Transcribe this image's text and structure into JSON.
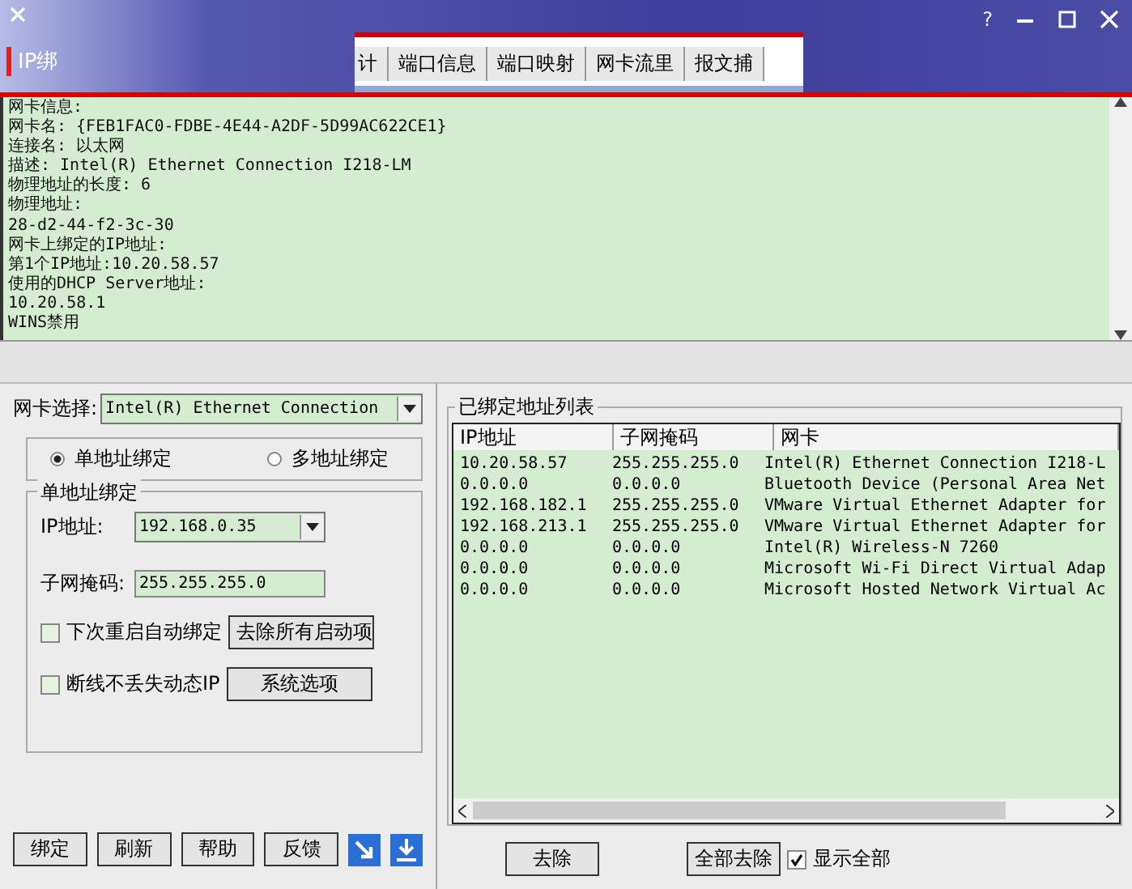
{
  "title_bar": {
    "app_tab": "IP绑",
    "tabs": [
      {
        "label": "计",
        "selected": false
      },
      {
        "label": "端口信息",
        "selected": false
      },
      {
        "label": "端口映射",
        "selected": false
      },
      {
        "label": "网卡流里",
        "selected": false
      },
      {
        "label": "报文捕",
        "selected": false
      }
    ],
    "help": "?"
  },
  "info": {
    "lines": [
      "网卡信息:",
      "网卡名: {FEB1FAC0-FDBE-4E44-A2DF-5D99AC622CE1}",
      "连接名: 以太网",
      "描述: Intel(R) Ethernet Connection I218-LM",
      "物理地址的长度: 6",
      "物理地址:",
      "28-d2-44-f2-3c-30",
      "网卡上绑定的IP地址:",
      "第1个IP地址:10.20.58.57",
      "使用的DHCP Server地址:",
      "10.20.58.1",
      "WINS禁用"
    ]
  },
  "left_panel": {
    "adapter_label": "网卡选择:",
    "adapter_value": "Intel(R) Ethernet Connection",
    "modes": [
      {
        "label": "单地址绑定",
        "selected": true
      },
      {
        "label": "多地址绑定",
        "selected": false
      }
    ],
    "group_title": "单地址绑定",
    "ip_label": "IP地址:",
    "ip_value": "192.168.0.35",
    "mask_label": "子网掩码:",
    "mask_value": "255.255.255.0",
    "options": [
      {
        "label": "下次重启自动绑定",
        "checked": false,
        "button": "去除所有启动项"
      },
      {
        "label": "断线不丢失动态IP",
        "checked": false,
        "button": "系统选项"
      }
    ],
    "buttons": [
      "绑定",
      "刷新",
      "帮助",
      "反馈"
    ]
  },
  "right_panel": {
    "group_title": "已绑定地址列表",
    "columns": [
      "IP地址",
      "子网掩码",
      "网卡"
    ],
    "rows": [
      [
        "10.20.58.57",
        "255.255.255.0",
        "Intel(R) Ethernet Connection I218-L"
      ],
      [
        "0.0.0.0",
        "0.0.0.0",
        "Bluetooth Device (Personal Area Net"
      ],
      [
        "192.168.182.1",
        "255.255.255.0",
        "VMware Virtual Ethernet Adapter for"
      ],
      [
        "192.168.213.1",
        "255.255.255.0",
        "VMware Virtual Ethernet Adapter for"
      ],
      [
        "0.0.0.0",
        "0.0.0.0",
        "Intel(R) Wireless-N 7260"
      ],
      [
        "0.0.0.0",
        "0.0.0.0",
        "Microsoft Wi-Fi Direct Virtual Adap"
      ],
      [
        "0.0.0.0",
        "0.0.0.0",
        "Microsoft Hosted Network Virtual Ac"
      ]
    ],
    "remove": "去除",
    "remove_all": "全部去除",
    "show_all": {
      "label": "显示全部",
      "checked": true
    }
  }
}
